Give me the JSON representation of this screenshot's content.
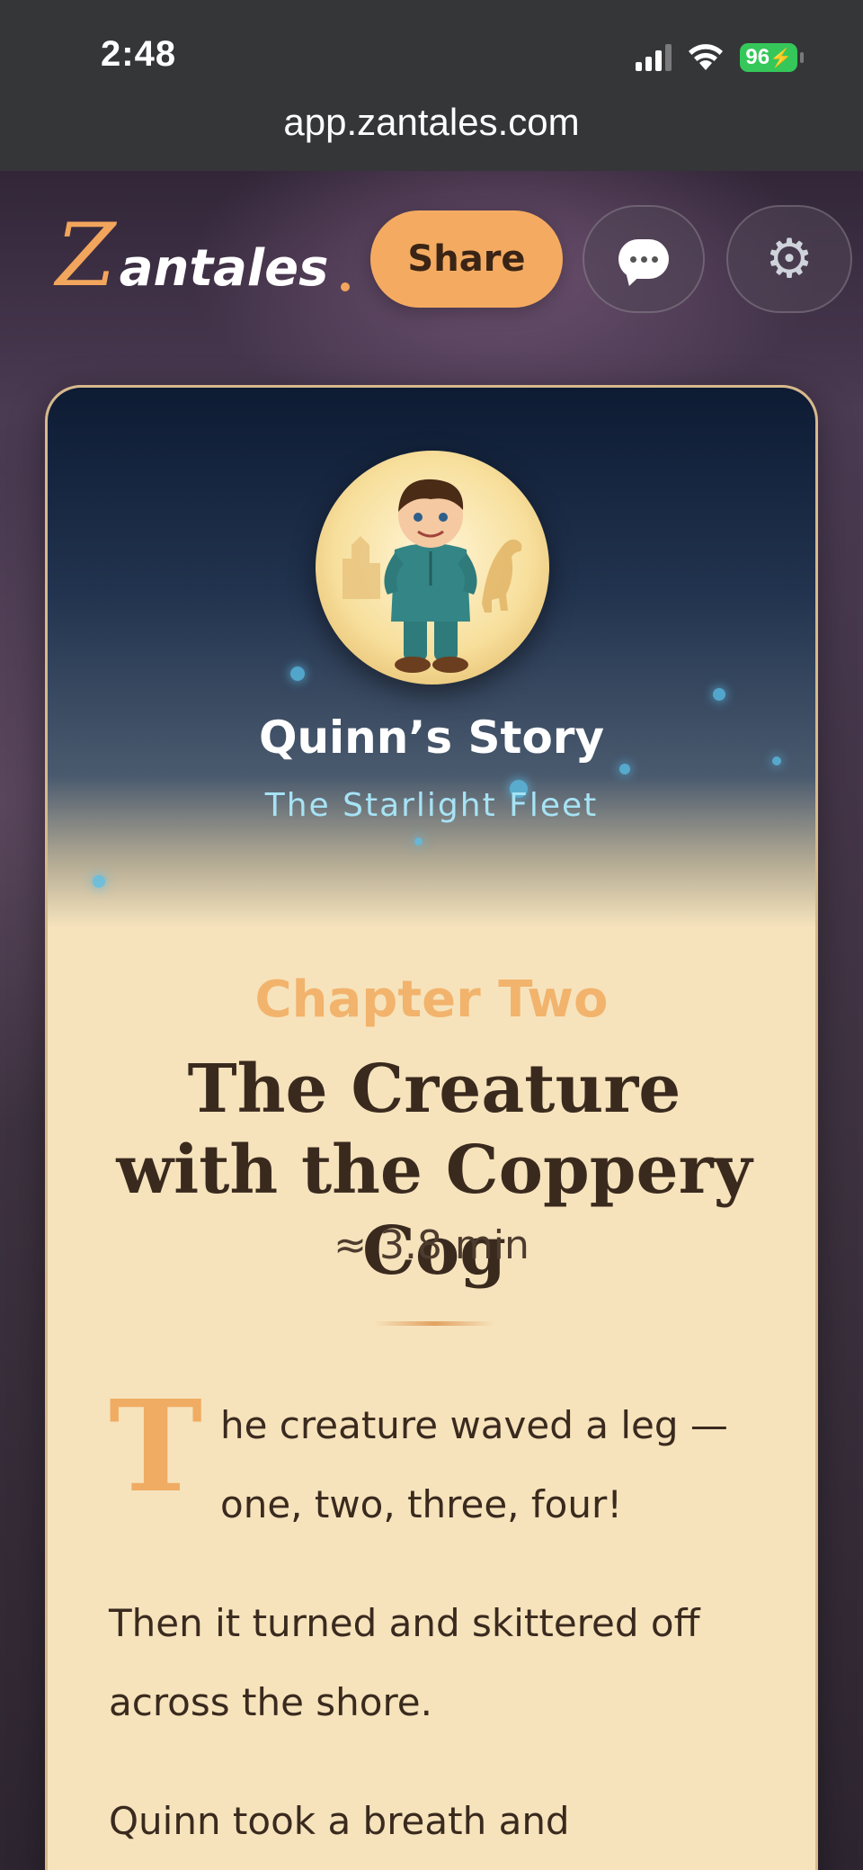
{
  "status_bar": {
    "time": "2:48",
    "battery": "96"
  },
  "browser": {
    "url": "app.zantales.com"
  },
  "header": {
    "logo_initial": "Z",
    "logo_rest": "antales",
    "share_label": "Share",
    "chat_icon": "chat-bubble-icon",
    "settings_icon": "gear-icon"
  },
  "story": {
    "name": "Quinn’s Story",
    "series": "The Starlight Fleet",
    "chapter_label": "Chapter Two",
    "chapter_title": "The Creature with the Coppery Cog",
    "read_time": "≈ 3.8 min",
    "drop_cap": "T",
    "paragraphs": [
      "he creature waved a leg — one, two, three, four!",
      "Then it turned and skittered off across the shore.",
      "Quinn took a breath and"
    ]
  },
  "colors": {
    "accent": "#f4ab61",
    "title_text": "#3a2a1e",
    "subtitle": "#a6e3f5",
    "paper": "#f6e3bc",
    "battery": "#35c759"
  }
}
